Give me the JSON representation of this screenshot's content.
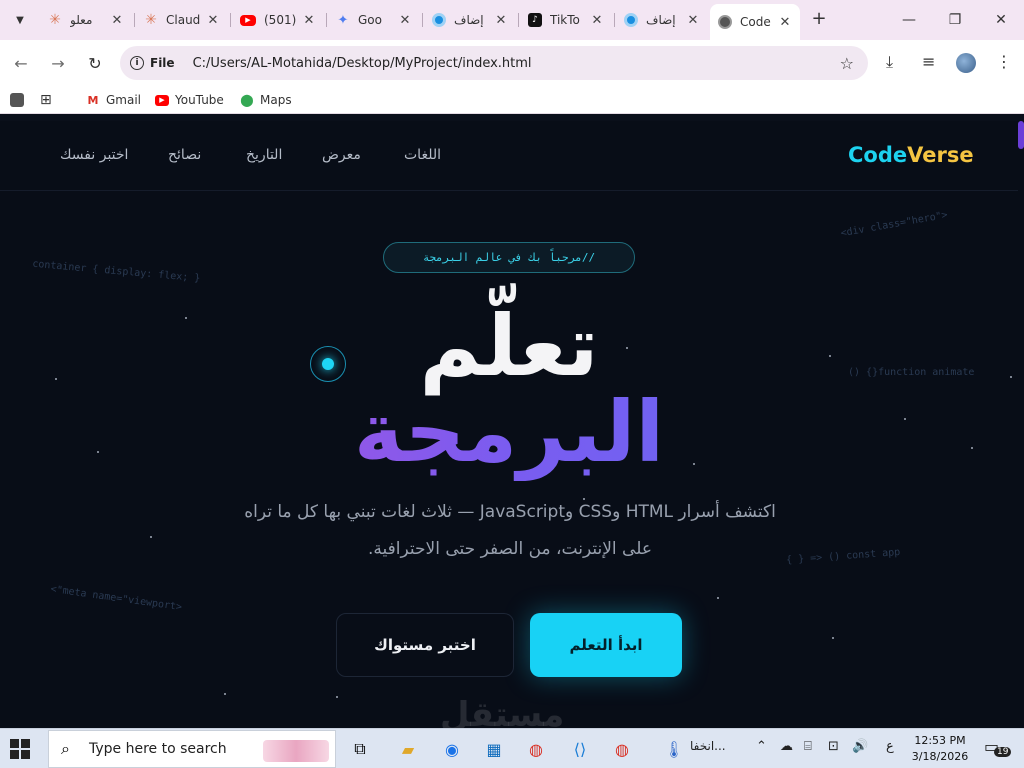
{
  "browser": {
    "tabs": [
      {
        "title": "معلو",
        "favicon": "claude-burst-icon",
        "color": "#d97757"
      },
      {
        "title": "Claud",
        "favicon": "claude-burst-icon",
        "color": "#d97757"
      },
      {
        "title": "(501)",
        "favicon": "youtube-icon",
        "color": "#ff0000"
      },
      {
        "title": "Goo",
        "favicon": "gemini-icon",
        "color": "#4f7df0"
      },
      {
        "title": "إضاف",
        "favicon": "circle-blue-icon",
        "color": "#1a8fe0"
      },
      {
        "title": "TikTo",
        "favicon": "tiktok-icon",
        "color": "#111111"
      },
      {
        "title": "إضاف",
        "favicon": "circle-blue-icon",
        "color": "#1a8fe0"
      },
      {
        "title": "Code",
        "favicon": "globe-icon",
        "color": "#444444"
      }
    ],
    "address": {
      "scheme_label": "File",
      "url": "C:/Users/AL-Motahida/Desktop/MyProject/index.html"
    },
    "bookmarks": [
      {
        "label": "Gmail",
        "icon": "gmail-icon"
      },
      {
        "label": "YouTube",
        "icon": "youtube-icon"
      },
      {
        "label": "Maps",
        "icon": "maps-icon"
      }
    ]
  },
  "site": {
    "logo_part1": "Code",
    "logo_part2": "Verse",
    "nav": [
      "اللغات",
      "معرض",
      "التاريخ",
      "نصائح",
      "اختبر نفسك"
    ],
    "badge": "//مرحباً بك في عالم البرمجة",
    "title_line1": "تعلّم",
    "title_line2": "البرمجة",
    "lead_line1": "اكتشف أسرار HTML وCSS وJavaScript — ثلاث لغات تبني بها كل ما تراه",
    "lead_line2": "على الإنترنت، من الصفر حتى الاحترافية.",
    "btn_primary": "ابدأ التعلم",
    "btn_secondary": "اختبر مستواك",
    "code_deco": [
      "<div class=\"hero\">",
      "container { display: flex; }",
      "() {}function animate",
      "{ } => () const app",
      "<\"meta name=\"viewport>"
    ],
    "watermark": "مستقل",
    "colors": {
      "accent": "#18d2f5",
      "gradient_start": "#c04fd6",
      "gradient_end": "#5f6ef6",
      "logo_verse": "#f5c542"
    }
  },
  "taskbar": {
    "search_placeholder": "Type here to search",
    "app_label": "انخفا...",
    "lang": "ع",
    "time": "12:53 PM",
    "date": "3/18/2026",
    "notifications": "19"
  }
}
